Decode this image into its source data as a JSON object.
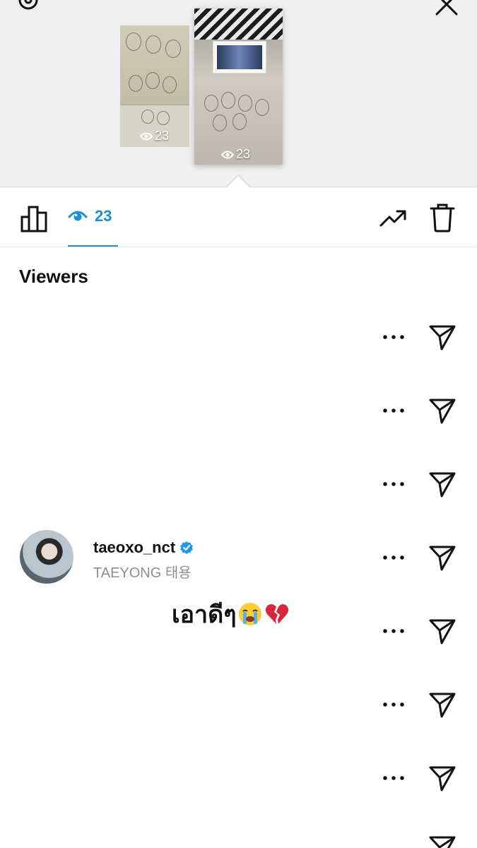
{
  "story_previews": {
    "left": {
      "views": "23"
    },
    "right": {
      "views": "23"
    }
  },
  "tabs": {
    "insights_icon": "bar-chart-icon",
    "viewers_count": "23",
    "promote_icon": "trending-up-icon",
    "delete_icon": "trash-icon"
  },
  "viewers": {
    "heading": "Viewers",
    "featured": {
      "username": "taeoxo_nct",
      "full_name": "TAEYONG 태용",
      "verified": true
    }
  },
  "caption": {
    "text": "เอาดีๆ",
    "emojis": [
      "loudly-crying-face",
      "broken-heart"
    ]
  },
  "colors": {
    "accent": "#1a8fd6",
    "verified": "#2196f3"
  }
}
